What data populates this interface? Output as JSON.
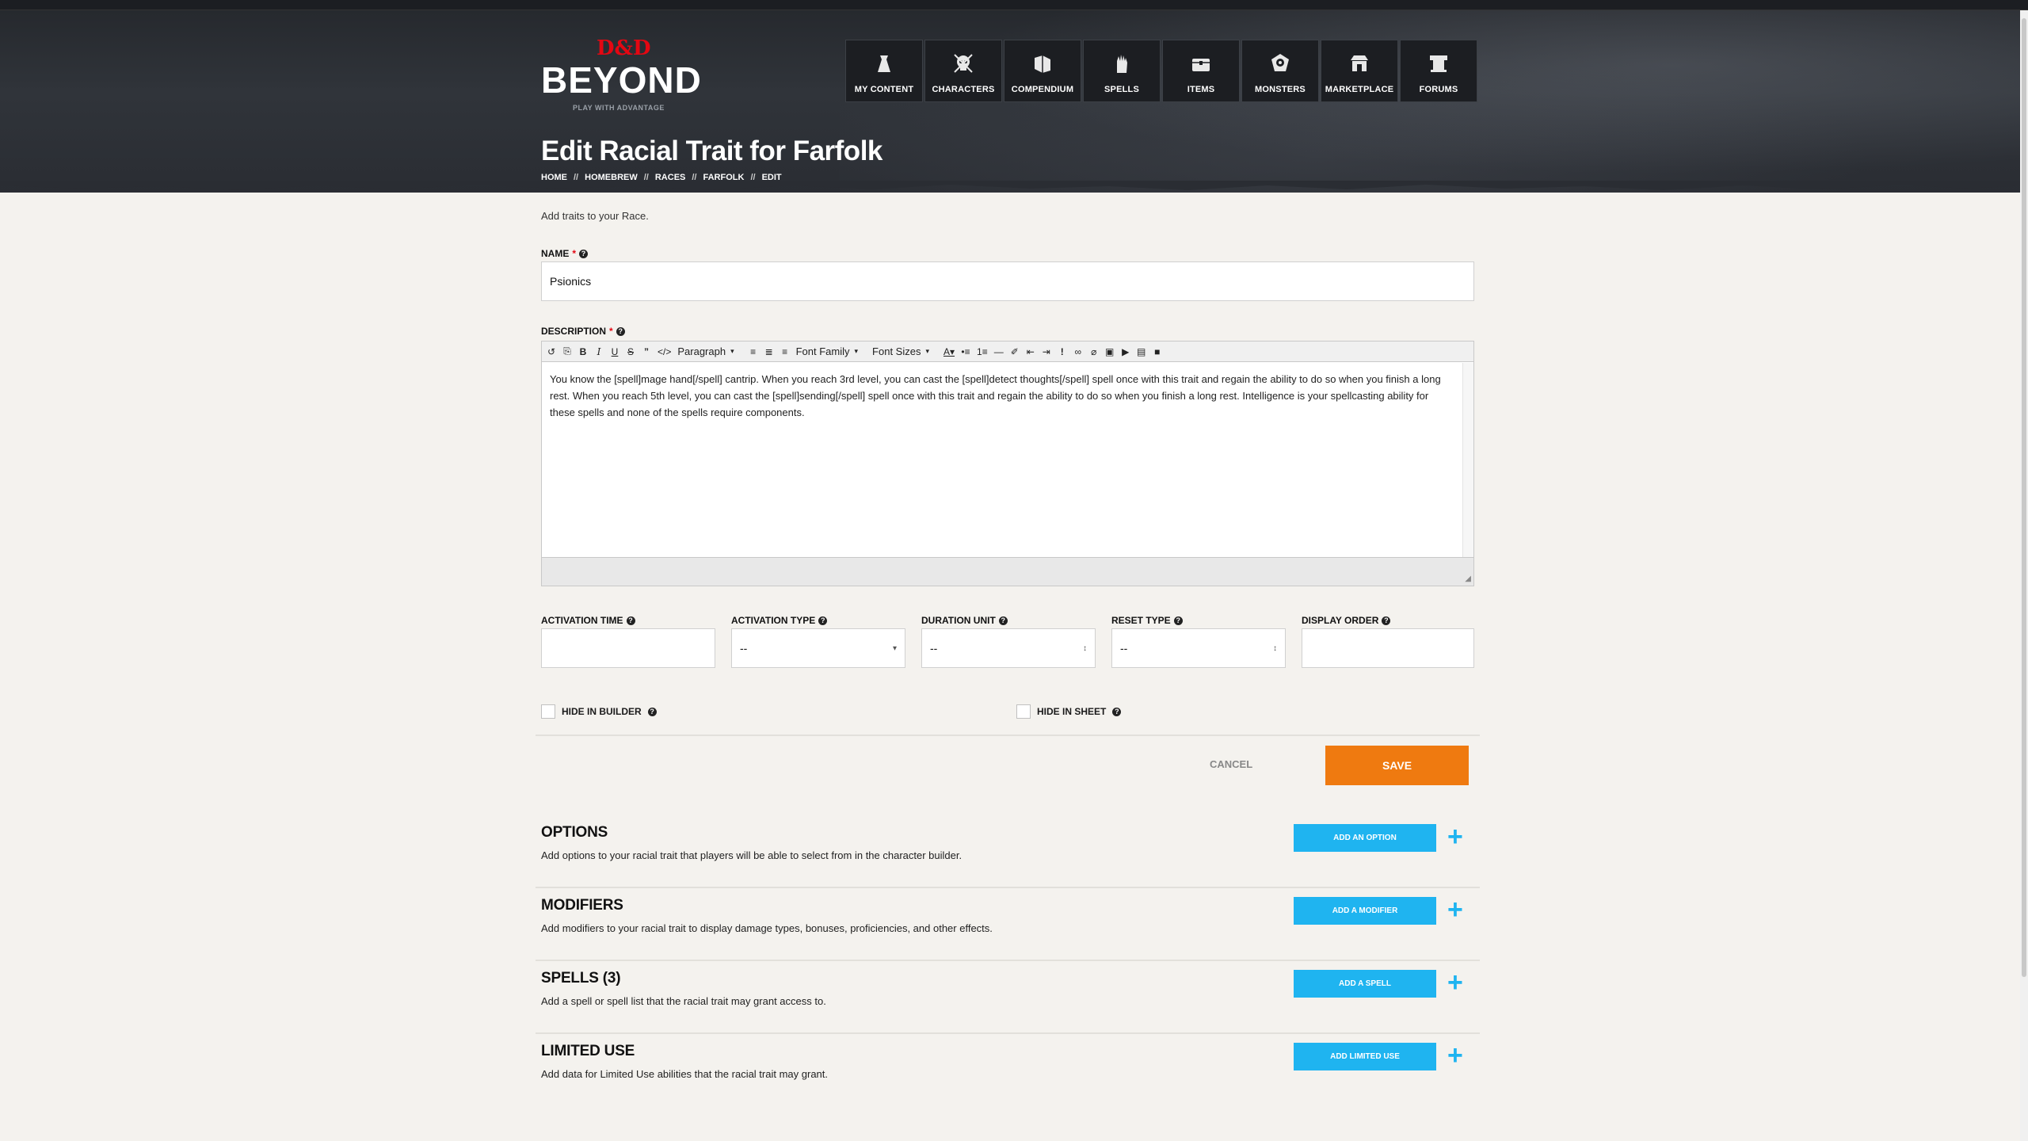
{
  "logo": {
    "dnd": "D&D",
    "brand": "BEYOND",
    "tagline": "PLAY WITH ADVANTAGE"
  },
  "nav": [
    {
      "label": "MY CONTENT",
      "icon": "bag-icon"
    },
    {
      "label": "CHARACTERS",
      "icon": "skull-icon"
    },
    {
      "label": "COMPENDIUM",
      "icon": "book-icon"
    },
    {
      "label": "SPELLS",
      "icon": "hand-spell-icon"
    },
    {
      "label": "ITEMS",
      "icon": "chest-icon"
    },
    {
      "label": "MONSTERS",
      "icon": "monster-icon"
    },
    {
      "label": "MARKETPLACE",
      "icon": "store-icon"
    },
    {
      "label": "FORUMS",
      "icon": "forum-icon"
    }
  ],
  "page": {
    "title": "Edit Racial Trait for Farfolk"
  },
  "breadcrumb": [
    "HOME",
    "HOMEBREW",
    "RACES",
    "FARFOLK",
    "EDIT"
  ],
  "breadcrumb_sep": "//",
  "form": {
    "intro": "Add traits to your Race.",
    "name_label": "NAME",
    "name_value": "Psionics",
    "description_label": "DESCRIPTION",
    "required_mark": "*",
    "toolbar": {
      "paragraph": "Paragraph",
      "font_family": "Font Family",
      "font_sizes": "Font Sizes"
    },
    "description_value": "You know the [spell]mage hand[/spell] cantrip. When you reach 3rd level, you can cast the [spell]detect thoughts[/spell] spell once with this trait and regain the ability to do so when you finish a long rest. When you reach 5th level, you can cast the [spell]sending[/spell] spell once with this trait and regain the ability to do so when you finish a long rest. Intelligence is your spellcasting ability for these spells and none of the spells require components.",
    "activation_time_label": "ACTIVATION TIME",
    "activation_type_label": "ACTIVATION TYPE",
    "activation_type_value": "--",
    "duration_unit_label": "DURATION UNIT",
    "duration_unit_value": "--",
    "reset_type_label": "RESET TYPE",
    "reset_type_value": "--",
    "display_order_label": "DISPLAY ORDER",
    "hide_builder_label": "HIDE IN BUILDER",
    "hide_sheet_label": "HIDE IN SHEET",
    "cancel_label": "CANCEL",
    "save_label": "SAVE"
  },
  "sections": [
    {
      "title": "OPTIONS",
      "desc": "Add options to your racial trait that players will be able to select from in the character builder.",
      "button": "ADD AN OPTION"
    },
    {
      "title": "MODIFIERS",
      "desc": "Add modifiers to your racial trait to display damage types, bonuses, proficiencies, and other effects.",
      "button": "ADD A MODIFIER"
    },
    {
      "title": "SPELLS (3)",
      "desc": "Add a spell or spell list that the racial trait may grant access to.",
      "button": "ADD A SPELL"
    },
    {
      "title": "LIMITED USE",
      "desc": "Add data for Limited Use abilities that the racial trait may grant.",
      "button": "ADD LIMITED USE"
    }
  ],
  "colors": {
    "accent_orange": "#ef7a10",
    "accent_blue": "#1fb4f0",
    "brand_red": "#e40712",
    "header_dark": "#2a2d33"
  }
}
